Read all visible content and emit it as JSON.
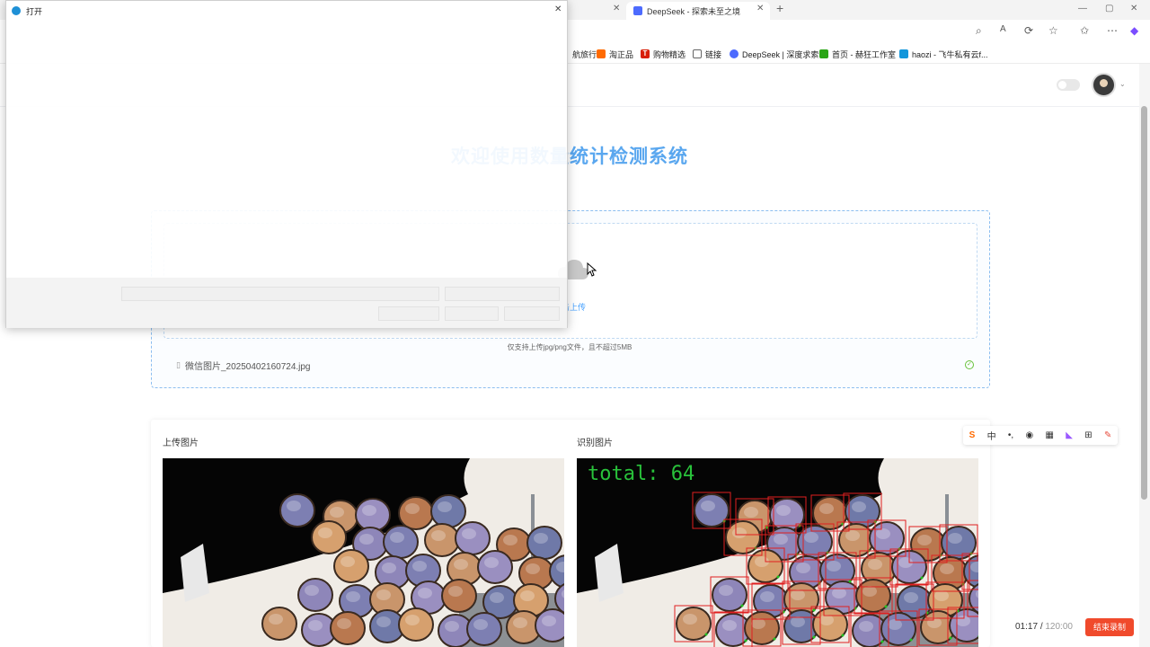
{
  "browser": {
    "tabs": [
      {
        "label": "打开"
      },
      {
        "label": "DeepSeek - 探索未至之境"
      }
    ],
    "new_tab_label": "+",
    "bookmarks": [
      {
        "label": "航旅行",
        "color": "#2b7de9"
      },
      {
        "label": "淘正品",
        "color": "#ff6a00"
      },
      {
        "label": "购物精选",
        "color": "#d81e06"
      },
      {
        "label": "链接",
        "color": "#666666"
      },
      {
        "label": "DeepSeek | 深度求索",
        "color": "#4d6bfe"
      },
      {
        "label": "首页 - 赫狂工作室",
        "color": "#2aa515"
      },
      {
        "label": "haozi - 飞牛私有云f...",
        "color": "#1296db"
      }
    ]
  },
  "page": {
    "title": "欢迎使用数量统计检测系统",
    "upload": {
      "click_upload": "点击上传",
      "separator": "/",
      "hint": "仅支持上传jpg/png文件，且不超过5MB",
      "file_name": "微信图片_20250402160724.jpg"
    },
    "results": {
      "upload_label": "上传图片",
      "detect_label": "识别图片",
      "total_text": "total: 64"
    }
  },
  "overlay": {
    "dialog_title": "打开"
  },
  "ime": {
    "lang": "中"
  },
  "recording": {
    "elapsed": "01:17",
    "separator": "/",
    "limit": "120:00",
    "stop_label": "结束录制"
  },
  "colors": {
    "accent": "#5aa7ef",
    "stop": "#f04a2c",
    "detect_box": "#e02020",
    "detect_point": "#22c322"
  }
}
